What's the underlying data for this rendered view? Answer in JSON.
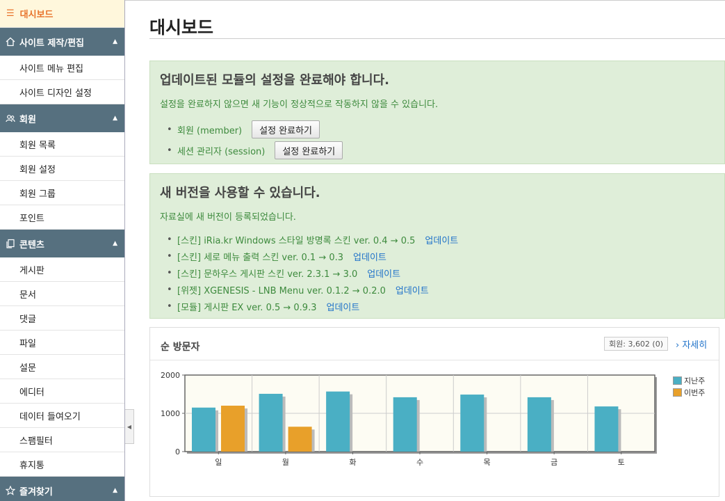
{
  "sidebar": {
    "dashboard_label": "대시보드",
    "groups": [
      {
        "label": "사이트 제작/편집",
        "icon": "home-icon",
        "items": [
          "사이트 메뉴 편집",
          "사이트 디자인 설정"
        ]
      },
      {
        "label": "회원",
        "icon": "users-icon",
        "items": [
          "회원 목록",
          "회원 설정",
          "회원 그룹",
          "포인트"
        ]
      },
      {
        "label": "콘텐츠",
        "icon": "documents-icon",
        "items": [
          "게시판",
          "문서",
          "댓글",
          "파일",
          "설문",
          "에디터",
          "데이터 들여오기",
          "스팸필터",
          "휴지통"
        ]
      },
      {
        "label": "즐겨찾기",
        "icon": "star-icon",
        "items": []
      }
    ]
  },
  "main": {
    "title": "대시보드",
    "module_alert": {
      "heading": "업데이트된 모듈의 설정을 완료해야 합니다.",
      "description": "설정을 완료하지 않으면 새 기능이 정상적으로 작동하지 않을 수 있습니다.",
      "items": [
        {
          "name": "회원 (member)",
          "button": "설정 완료하기"
        },
        {
          "name": "세션 관리자 (session)",
          "button": "설정 완료하기"
        }
      ]
    },
    "version_alert": {
      "heading": "새 버전을 사용할 수 있습니다.",
      "description": "자료실에 새 버전이 등록되었습니다.",
      "items": [
        {
          "text": "[스킨] iRia.kr Windows 스타일 방명록 스킨 ver. 0.4 → 0.5",
          "link": "업데이트"
        },
        {
          "text": "[스킨] 세로 메뉴 출력 스킨 ver. 0.1 → 0.3",
          "link": "업데이트"
        },
        {
          "text": "[스킨] 문하우스 게시판 스킨 ver. 2.3.1 → 3.0",
          "link": "업데이트"
        },
        {
          "text": "[위젯] XGENESIS - LNB Menu ver. 0.1.2 → 0.2.0",
          "link": "업데이트"
        },
        {
          "text": "[모듈] 게시판 EX ver. 0.5 → 0.9.3",
          "link": "업데이트"
        }
      ]
    },
    "visitors": {
      "title": "순 방문자",
      "member_count": "회원: 3,602 (0)",
      "more_link": "› 자세히"
    }
  },
  "colors": {
    "last_week": "#4aafc4",
    "this_week": "#e8a02a",
    "plot_bg": "#fdfcf3"
  },
  "chart_data": {
    "type": "bar",
    "categories": [
      "일",
      "월",
      "화",
      "수",
      "목",
      "금",
      "토"
    ],
    "series": [
      {
        "name": "지난주",
        "values": [
          1150,
          1510,
          1570,
          1420,
          1490,
          1420,
          1180
        ]
      },
      {
        "name": "이번주",
        "values": [
          1200,
          650,
          null,
          null,
          null,
          null,
          null
        ]
      }
    ],
    "y_ticks": [
      "0",
      "1000",
      "2000"
    ],
    "ylim": [
      0,
      2000
    ],
    "grid": true,
    "legend": "right"
  }
}
